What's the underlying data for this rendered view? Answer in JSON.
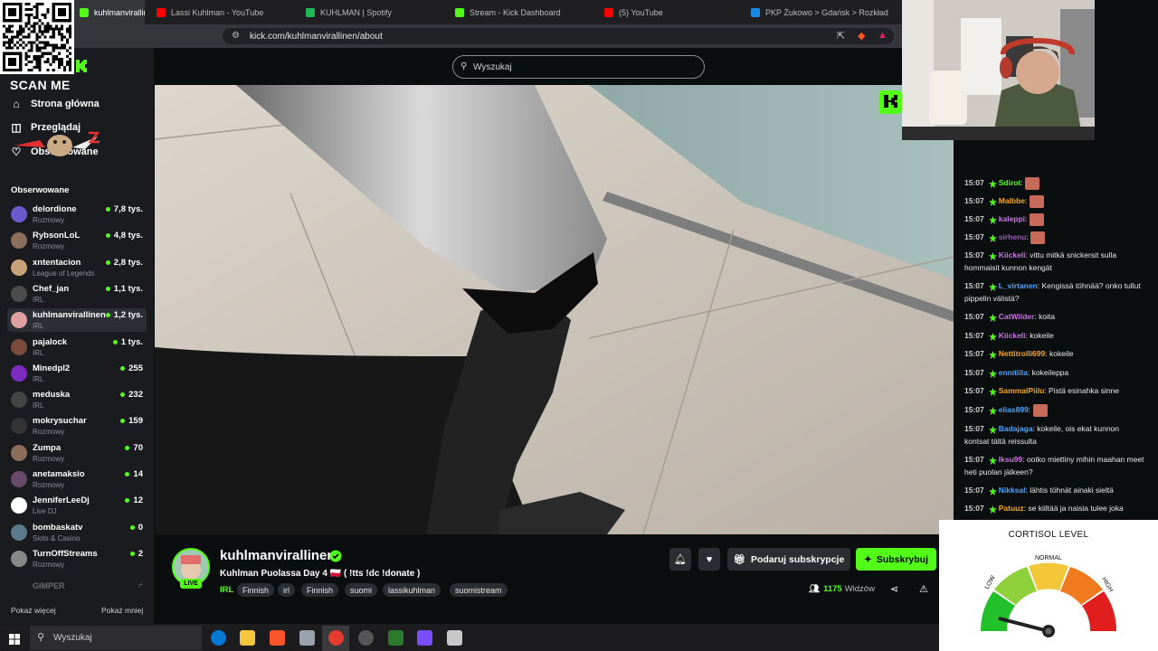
{
  "browser": {
    "tabs": [
      {
        "label": "kuhlmanvirallinen - W",
        "active": true,
        "color": "#53fc18"
      },
      {
        "label": "Lassi Kuhlman - YouTube",
        "active": false,
        "color": "#ff0000"
      },
      {
        "label": "KUHLMAN | Spotify",
        "active": false,
        "color": "#1db954"
      },
      {
        "label": "Stream - Kick Dashboard",
        "active": false,
        "color": "#53fc18"
      },
      {
        "label": "(5) YouTube",
        "active": false,
        "color": "#ff0000"
      },
      {
        "label": "PKP Żukowo > Gdańsk > Rozkład jaz",
        "active": false,
        "color": "#1e88e5"
      }
    ],
    "url": "kick.com/kuhlmanvirallinen/about"
  },
  "qr": {
    "caption": "SCAN ME"
  },
  "search": {
    "placeholder": "Wyszukaj"
  },
  "sidebar": {
    "nav": [
      {
        "label": "Strona główna",
        "icon": "home-icon"
      },
      {
        "label": "Przeglądaj",
        "icon": "browse-icon"
      },
      {
        "label": "Obserwowane",
        "icon": "heart-icon"
      }
    ],
    "followed_heading": "Obserwowane",
    "channels": [
      {
        "name": "delordione",
        "category": "Rozmowy",
        "viewers": "7,8 tys.",
        "color": "#6a5acd"
      },
      {
        "name": "RybsonLoL",
        "category": "Rozmowy",
        "viewers": "4,8 tys.",
        "color": "#8b6f5a"
      },
      {
        "name": "xntentacion",
        "category": "League of Legends",
        "viewers": "2,8 tys.",
        "color": "#c9a27a"
      },
      {
        "name": "Chef_jan",
        "category": "IRL",
        "viewers": "1,1 tys.",
        "color": "#4b4b4b"
      },
      {
        "name": "kuhlmanvirallinen",
        "category": "IRL",
        "viewers": "1,2 tys.",
        "color": "#e0a0a0",
        "active": true
      },
      {
        "name": "pajalock",
        "category": "IRL",
        "viewers": "1 tys.",
        "color": "#7a4a3a"
      },
      {
        "name": "Minedpl2",
        "category": "IRL",
        "viewers": "255",
        "color": "#7b2cbf"
      },
      {
        "name": "meduska",
        "category": "IRL",
        "viewers": "232",
        "color": "#444"
      },
      {
        "name": "mokrysuchar",
        "category": "Rozmowy",
        "viewers": "159",
        "color": "#333"
      },
      {
        "name": "Zumpa",
        "category": "Rozmowy",
        "viewers": "70",
        "color": "#8a6d5a"
      },
      {
        "name": "anetamaksio",
        "category": "Rozmowy",
        "viewers": "14",
        "color": "#6a4a6a"
      },
      {
        "name": "JenniferLeeDj",
        "category": "Live DJ",
        "viewers": "12",
        "color": "#fff"
      },
      {
        "name": "bombaskatv",
        "category": "Slots & Casino",
        "viewers": "0",
        "color": "#5a7a8a"
      },
      {
        "name": "TurnOffStreams",
        "category": "Rozmowy",
        "viewers": "2",
        "color": "#888"
      }
    ],
    "faded_channel": "GIMPER",
    "show_more": "Pokaż więcej",
    "show_less": "Pokaż mniej"
  },
  "stream": {
    "streamer": "kuhlmanvirallinen",
    "live_label": "LIVE",
    "title": "Kuhlman Puolassa Day 4 🇵🇱 ( !tts !dc !donate )",
    "category": "IRL",
    "tags": [
      "Finnish",
      "irl",
      "Finnish",
      "suomi",
      "lassikuhlman",
      "suomistream"
    ],
    "gift_label": "Podaruj subskrypcje",
    "subscribe_label": "Subskrybuj",
    "viewer_count": "1175",
    "viewer_label": "Widzów"
  },
  "chat": {
    "messages": [
      {
        "time": "15:07",
        "user": "Sdirot",
        "text": "",
        "color": "#53fc18",
        "emote": true
      },
      {
        "time": "15:07",
        "user": "Malbbe",
        "text": "",
        "color": "#f5a623",
        "emote": true
      },
      {
        "time": "15:07",
        "user": "kaleppi",
        "text": "",
        "color": "#c678dd",
        "emote": true
      },
      {
        "time": "15:07",
        "user": "sirhenu",
        "text": "",
        "color": "#9b59b6",
        "emote": true
      },
      {
        "time": "15:07",
        "user": "Kiickeli",
        "text": "vittu mitkä snickersit sulla hommaisit kunnon kengät",
        "color": "#c678dd"
      },
      {
        "time": "15:07",
        "user": "L_virtanen",
        "text": "Kengissä töhnää? onko tullut pippelin välistä?",
        "color": "#4fa3ff"
      },
      {
        "time": "15:07",
        "user": "CatWilder",
        "text": "koita",
        "color": "#c678dd"
      },
      {
        "time": "15:07",
        "user": "Kiickeli",
        "text": "kokeile",
        "color": "#c678dd"
      },
      {
        "time": "15:07",
        "user": "Nettitrolli699",
        "text": "kokeile",
        "color": "#f5a623"
      },
      {
        "time": "15:07",
        "user": "ennitiila",
        "text": "kokeileppa",
        "color": "#4fa3ff"
      },
      {
        "time": "15:07",
        "user": "SammalPiilu",
        "text": "Pistä esinahka sinne",
        "color": "#f5a623"
      },
      {
        "time": "15:07",
        "user": "elias899",
        "text": "",
        "color": "#4fa3ff",
        "emote": true
      },
      {
        "time": "15:07",
        "user": "Badajaga",
        "text": "kokeile, ois ekat kunnon kontsat tältä reissulta",
        "color": "#4fa3ff"
      },
      {
        "time": "15:07",
        "user": "Iksu99",
        "text": "ootko miettiny mihin maahan meet heti puolan jälkeen?",
        "color": "#c678dd"
      },
      {
        "time": "15:07",
        "user": "Nikksal",
        "text": "lähtis töhnät ainaki sieltä",
        "color": "#4fa3ff"
      },
      {
        "time": "15:07",
        "user": "Patuuz",
        "text": "se kiiltää ja naisia tulee joka",
        "color": "#f5a623"
      }
    ]
  },
  "cortisol": {
    "title": "CORTISOL LEVEL",
    "low": "LOW",
    "normal": "NORMAL",
    "high": "HIGH",
    "level": 0.08
  },
  "taskbar": {
    "search_placeholder": "Wyszukaj"
  }
}
